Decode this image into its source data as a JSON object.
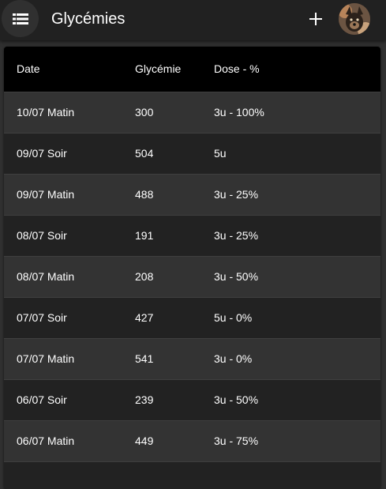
{
  "header": {
    "title": "Glycémies",
    "menu_icon": "list-icon",
    "add_icon": "plus-icon",
    "avatar_icon": "user-avatar"
  },
  "colors": {
    "app_bar": "#212121",
    "background": "#303030",
    "table_header": "#000000",
    "row_odd": "#333333",
    "row_even": "#222222",
    "text": "#ffffff"
  },
  "table": {
    "columns": [
      "Date",
      "Glycémie",
      "Dose - %"
    ],
    "rows": [
      [
        "10/07 Matin",
        "300",
        "3u - 100%"
      ],
      [
        "09/07 Soir",
        "504",
        "5u"
      ],
      [
        "09/07 Matin",
        "488",
        "3u - 25%"
      ],
      [
        "08/07 Soir",
        "191",
        "3u - 25%"
      ],
      [
        "08/07 Matin",
        "208",
        "3u - 50%"
      ],
      [
        "07/07 Soir",
        "427",
        "5u - 0%"
      ],
      [
        "07/07 Matin",
        "541",
        "3u - 0%"
      ],
      [
        "06/07 Soir",
        "239",
        "3u - 50%"
      ],
      [
        "06/07 Matin",
        "449",
        "3u - 75%"
      ]
    ]
  }
}
